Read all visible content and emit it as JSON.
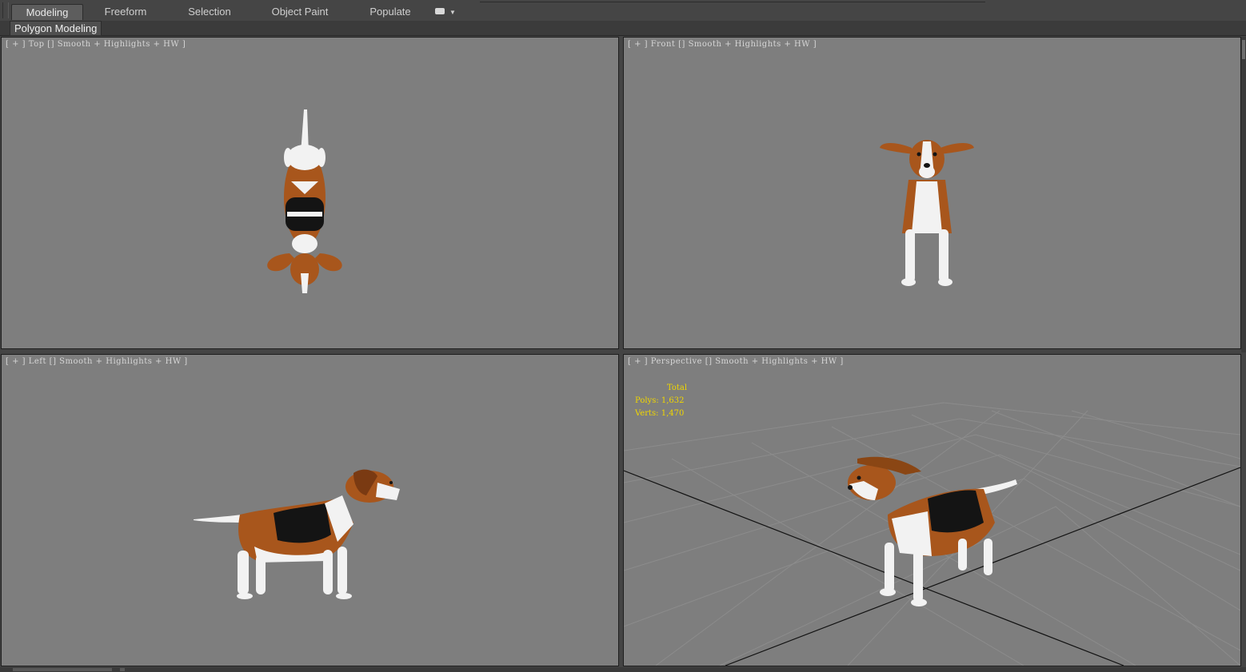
{
  "ribbon": {
    "tabs": [
      {
        "label": "Modeling",
        "active": true
      },
      {
        "label": "Freeform",
        "active": false
      },
      {
        "label": "Selection",
        "active": false
      },
      {
        "label": "Object Paint",
        "active": false
      },
      {
        "label": "Populate",
        "active": false
      }
    ],
    "panel_title": "Polygon Modeling"
  },
  "viewports": {
    "top": {
      "label": "[ + ] Top [] Smooth + Highlights + HW ]"
    },
    "front": {
      "label": "[ + ] Front [] Smooth + Highlights + HW ]"
    },
    "left": {
      "label": "[ + ] Left [] Smooth + Highlights + HW ]"
    },
    "perspective": {
      "label": "[ + ] Perspective [] Smooth + Highlights + HW ]"
    }
  },
  "stats": {
    "title": "Total",
    "polys": "Polys: 1,632",
    "verts": "Verts: 1,470"
  },
  "colors": {
    "viewport_bg": "#7e7e7e",
    "stats_text": "#f0d600",
    "fur_brown": "#a8561c",
    "fur_white": "#f2f2f2",
    "fur_black": "#141414"
  },
  "icons": [
    "ribbon-minimize-icon",
    "dropdown-caret-icon"
  ]
}
